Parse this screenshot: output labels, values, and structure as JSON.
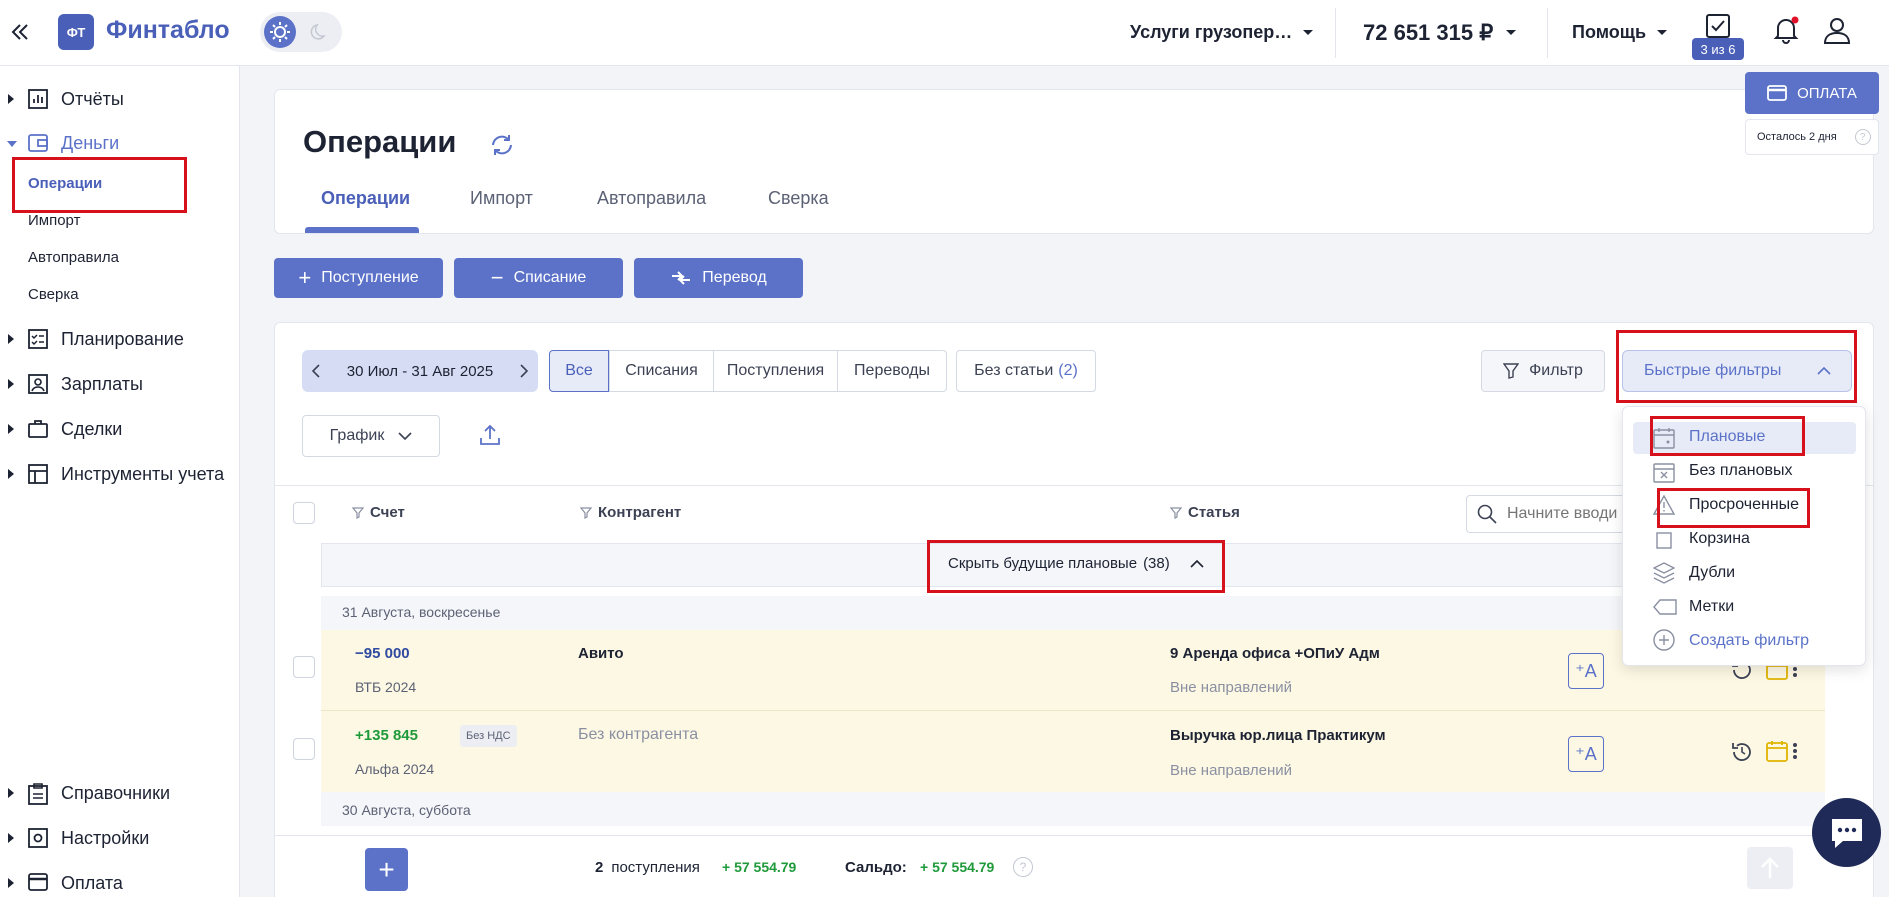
{
  "header": {
    "logo_mark": "ФТ",
    "logo_text": "Финтабло",
    "company": "Услуги грузопер…",
    "balance": "72 651 315 ₽",
    "help": "Помощь",
    "tasks_badge": "3 из 6"
  },
  "sidebar": {
    "reports": "Отчёты",
    "money": "Деньги",
    "money_sub": [
      "Операции",
      "Импорт",
      "Автоправила",
      "Сверка"
    ],
    "planning": "Планирование",
    "salaries": "Зарплаты",
    "deals": "Сделки",
    "tools": "Инструменты учета",
    "references": "Справочники",
    "settings": "Настройки",
    "payment": "Оплата"
  },
  "payment_card": {
    "button": "ОПЛАТА",
    "remaining": "Осталось 2 дня"
  },
  "page": {
    "title": "Операции",
    "tabs": [
      "Операции",
      "Импорт",
      "Автоправила",
      "Сверка"
    ]
  },
  "actions": {
    "income": "Поступление",
    "expense": "Списание",
    "transfer": "Перевод"
  },
  "filters": {
    "date_range": "30 Июл - 31 Авг 2025",
    "types": [
      "Все",
      "Списания",
      "Поступления",
      "Переводы"
    ],
    "no_article": "Без статьи",
    "no_article_count": "(2)",
    "filter": "Фильтр",
    "quick_filters": "Быстрые фильтры",
    "chart": "График"
  },
  "quick_menu": {
    "items": [
      "Плановые",
      "Без плановых",
      "Просроченные",
      "Корзина",
      "Дубли",
      "Метки"
    ],
    "create": "Создать фильтр"
  },
  "table": {
    "headers": [
      "Счет",
      "Контрагент",
      "Статья"
    ],
    "search_placeholder": "Начните вводить",
    "hide_planned": "Скрыть будущие плановые",
    "hide_planned_count": "(38)",
    "groups": [
      {
        "date": "31 Августа, воскресенье",
        "rows": [
          {
            "amount": "−95 000",
            "account": "ВТБ 2024",
            "counterparty": "Авито",
            "article": "9 Аренда офиса +ОПиУ Адм",
            "direction": "Вне направлений",
            "badge": ""
          },
          {
            "amount": "+135 845",
            "account": "Альфа 2024",
            "counterparty": "Без контрагента",
            "article": "Выручка юр.лица Практикум",
            "direction": "Вне направлений",
            "badge": "Без НДС"
          }
        ]
      },
      {
        "date": "30 Августа, суббота",
        "rows": []
      }
    ]
  },
  "footer": {
    "count": "2",
    "count_label": "поступления",
    "sum": "+ 57 554.79",
    "saldo_label": "Сальдо:",
    "saldo": "+ 57 554.79"
  }
}
